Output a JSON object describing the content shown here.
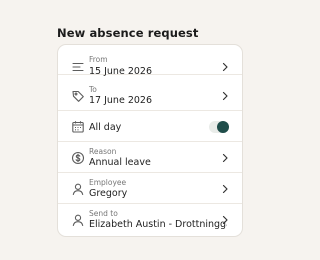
{
  "page": {
    "title": "New absence request"
  },
  "form": {
    "from": {
      "label": "From",
      "value": "15 June 2026",
      "icon": "filter-lines-icon"
    },
    "to": {
      "label": "To",
      "value": "17 June 2026",
      "icon": "tag-icon"
    },
    "all_day": {
      "label": "All day",
      "checked": true,
      "icon": "calendar-icon"
    },
    "reason": {
      "label": "Reason",
      "value": "Annual leave",
      "icon": "dollar-circle-icon"
    },
    "employee": {
      "label": "Employee",
      "value": "Gregory",
      "icon": "person-icon"
    },
    "send_to": {
      "label": "Send to",
      "value": "Elizabeth Austin - Drottninggatan",
      "icon": "person-icon"
    }
  },
  "colors": {
    "background": "#f6f3ef",
    "card": "#ffffff",
    "accent": "#1f4d4a"
  }
}
